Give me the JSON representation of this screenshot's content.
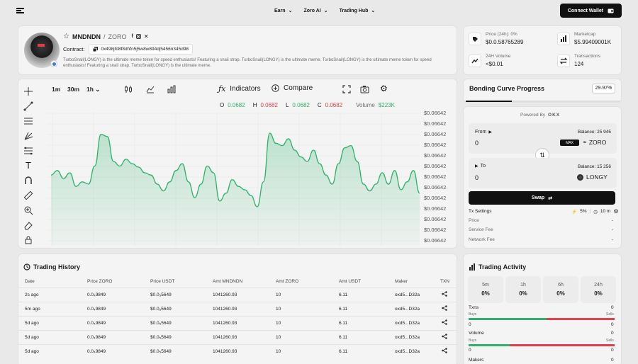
{
  "header": {
    "nav": [
      {
        "label": "Earn"
      },
      {
        "label": "Zoro AI"
      },
      {
        "label": "Trading Hub"
      }
    ],
    "connect_label": "Connect Wallet"
  },
  "token": {
    "name": "MNDNDN",
    "separator": "/",
    "pair": "ZORO",
    "contract_label": "Contract:",
    "contract": "0x498jfd8f8dhfn5j5w8w894dj5456n345d98",
    "description": "TurboSnail(LONGY) is the ultimate meme token for speed enthusiasts! Featuring a snail strap. TurboSnail(LONGY) is the ultimate meme. TurboSnail(LONGY) is the ultimate meme token for speed enthusiasts! Featuring a snail strap. TurboSnail(LONGY) is the ultimate meme."
  },
  "stats": {
    "price_label": "Price (24h): 0%",
    "price_value": "$0.0.58765289",
    "volume_label": "24H Volume",
    "volume_value": "<$0.01",
    "marketcap_label": "Marketcap",
    "marketcap_value": "$5.99409001K",
    "transactions_label": "Transactions",
    "transactions_value": "124"
  },
  "chart_toolbar": {
    "timeframes": [
      "1m",
      "30m",
      "1h"
    ],
    "indicators_label": "Indicators",
    "compare_label": "Compare"
  },
  "ohlc": {
    "o_label": "O",
    "o": "0.0682",
    "h_label": "H",
    "h": "0.0682",
    "l_label": "L",
    "l": "0.0682",
    "c_label": "C",
    "c": "0.0682",
    "vol_label": "Volume",
    "vol": "$223K"
  },
  "chart_data": {
    "type": "area",
    "y_ticks": [
      "$0.06642",
      "$0.06642",
      "$0.06642",
      "$0.06642",
      "$0.06642",
      "$0.06642",
      "$0.06642",
      "$0.06642",
      "$0.06642",
      "$0.06642",
      "$0.06642",
      "$0.06642",
      "$0.06642"
    ],
    "values": [
      0.58,
      0.62,
      0.55,
      0.6,
      0.48,
      0.52,
      0.5,
      0.66,
      0.94,
      0.92,
      0.7,
      0.66,
      0.72,
      0.68,
      0.65,
      0.6,
      0.58,
      0.5,
      0.44,
      0.52,
      0.62,
      0.68,
      0.52,
      0.38,
      0.5,
      0.66,
      0.6,
      0.35,
      0.42,
      0.54,
      0.48,
      0.45,
      0.4,
      0.3,
      0.52,
      0.95,
      0.86,
      0.84,
      0.9,
      0.8,
      0.74,
      0.7,
      0.8,
      0.68,
      0.58,
      0.5,
      0.68,
      0.82,
      0.84,
      0.7,
      0.5,
      0.44,
      0.5,
      0.6,
      0.5,
      0.62,
      0.45,
      0.52,
      0.62,
      0.42
    ]
  },
  "bonding": {
    "title": "Bonding Curve Progress",
    "percent": "29.97%",
    "percent_value": 0.2997
  },
  "swap": {
    "powered_by": "Powered By",
    "powered_brand": "OKX",
    "from_label": "From",
    "from_balance": "Balance: 25 945",
    "from_amount": "0",
    "max_label": "MAX",
    "from_token": "ZORO",
    "to_label": "To",
    "to_balance": "Balance: 15 256",
    "to_amount": "0",
    "to_token": "LONGY",
    "swap_label": "Swap",
    "tx_settings": "Tx Settings",
    "slippage": "5%",
    "time": "10 m",
    "price_label": "Price",
    "price_value": "-",
    "service_fee_label": "Service Fee",
    "service_fee_value": "-",
    "network_fee_label": "Network Fee",
    "network_fee_value": "-"
  },
  "history": {
    "title": "Trading History",
    "columns": [
      "Date",
      "Price ZORO",
      "Price USDT",
      "Amt MNDNDN",
      "Amt ZORO",
      "Amt USDT",
      "Maker",
      "TXN"
    ],
    "rows": [
      [
        "2s ago",
        "0.0₄9849",
        "$0.0₅5649",
        "1041260.93",
        "10",
        "6.11",
        "oxd5...D32a"
      ],
      [
        "5m ago",
        "0.0₄9849",
        "$0.0₅5649",
        "1041260.93",
        "10",
        "6.11",
        "oxd5...D32a"
      ],
      [
        "5d ago",
        "0.0₄9849",
        "$0.0₅5649",
        "1041260.93",
        "10",
        "6.11",
        "oxd5...D32a"
      ],
      [
        "5d ago",
        "0.0₄9849",
        "$0.0₅5649",
        "1041260.93",
        "10",
        "6.11",
        "oxd5...D32a"
      ],
      [
        "5d ago",
        "0.0₄9849",
        "$0.0₅5649",
        "1041260.93",
        "10",
        "6.11",
        "oxd5...D32a"
      ]
    ]
  },
  "activity": {
    "title": "Trading Activity",
    "periods": [
      {
        "label": "5m",
        "value": "0%"
      },
      {
        "label": "1h",
        "value": "0%"
      },
      {
        "label": "6h",
        "value": "0%"
      },
      {
        "label": "24h",
        "value": "0%"
      }
    ],
    "txns_label": "Txns",
    "txns_value": "0",
    "txn_buys_label": "Buys",
    "txn_sells_label": "Sells",
    "txn_buys": "0",
    "txn_sells": "0",
    "volume_label": "Volume",
    "volume_value": "0",
    "vol_buys_label": "Buys",
    "vol_sells_label": "Sells",
    "vol_buys": "0",
    "vol_sells": "0",
    "makers_label": "Makers",
    "makers_value": "0",
    "colors": {
      "buy": "#2db36b",
      "sell": "#e0414a"
    }
  }
}
